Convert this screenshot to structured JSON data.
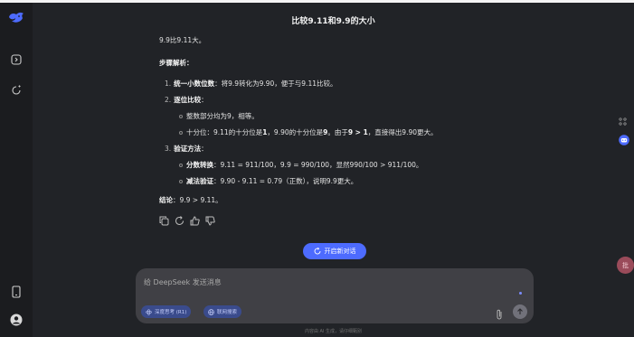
{
  "window": {
    "title": "比较9.11和9.9的大小"
  },
  "answer": {
    "intro": "9.9比9.11大。",
    "steps_heading": "步骤解析：",
    "step1": {
      "num": "1.",
      "label": "统一小数位数",
      "text": "：将9.9转化为9.90，便于与9.11比较。"
    },
    "step2": {
      "num": "2.",
      "label": "逐位比较",
      "text": "："
    },
    "step2_sub1": "整数部分均为9，相等。",
    "step2_sub2": {
      "pre": "十分位：9.11的十分位是",
      "v1": "1",
      "mid": "，9.90的十分位是",
      "v2": "9",
      "mid2": "。由于",
      "cmp": "9 > 1",
      "post": "，直接得出9.90更大。"
    },
    "step3": {
      "num": "3.",
      "label": "验证方法",
      "text": "："
    },
    "step3_sub1": {
      "label": "分数转换",
      "text": "：9.11 = 911/100，9.9 = 990/100，显然990/100 > 911/100。"
    },
    "step3_sub2": {
      "label": "减法验证",
      "text": "：9.90 - 9.11 = 0.79（正数），说明9.9更大。"
    },
    "conclusion": {
      "label": "结论",
      "text": "：9.9 > 9.11。"
    }
  },
  "new_chat": {
    "label": "开启新对话"
  },
  "input": {
    "placeholder": "给 DeepSeek 发送消息",
    "deep_think": "深度思考 (R1)",
    "web_search": "联网搜索"
  },
  "footer": {
    "text": "内容由 AI 生成，请仔细甄别"
  },
  "right_badge": {
    "text": "批"
  },
  "colors": {
    "accent": "#4d6bfe",
    "background": "#212327",
    "sidebar": "#1b1c1f",
    "input": "#404045"
  },
  "icons": {
    "logo": "deepseek-whale-icon",
    "sidebar_toggle": "sidebar-toggle-icon",
    "new_chat": "new-chat-icon",
    "phone": "phone-icon",
    "profile": "profile-icon"
  }
}
